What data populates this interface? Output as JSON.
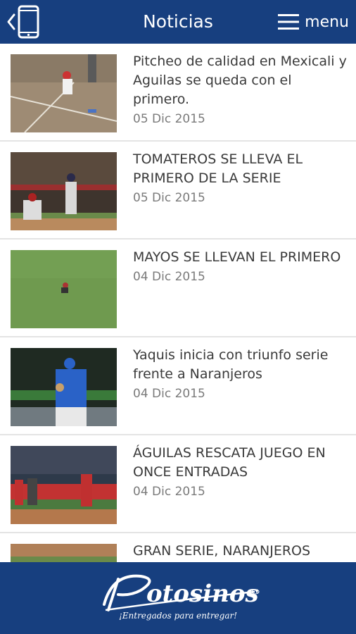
{
  "header": {
    "title": "Noticias",
    "menu_label": "menu"
  },
  "news": [
    {
      "headline": "Pitcheo de calidad en Mexicali y Aguilas se queda con el primero.",
      "date": "05 Dic 2015"
    },
    {
      "headline": "TOMATEROS SE LLEVA EL PRIMERO DE LA SERIE",
      "date": "05 Dic 2015"
    },
    {
      "headline": "MAYOS SE LLEVAN EL PRIMERO",
      "date": "04 Dic 2015"
    },
    {
      "headline": "Yaquis inicia con triunfo serie frente a Naranjeros",
      "date": "04 Dic 2015"
    },
    {
      "headline": "ÁGUILAS RESCATA JUEGO EN ONCE ENTRADAS",
      "date": "04 Dic 2015"
    },
    {
      "headline": "GRAN SERIE, NARANJEROS",
      "date": ""
    }
  ],
  "footer": {
    "logo_text": "Potosinos",
    "tagline": "¡Entregados para entregar!"
  },
  "colors": {
    "primary": "#173f7f",
    "text": "#3a3a3a",
    "date": "#7a7a7a"
  }
}
